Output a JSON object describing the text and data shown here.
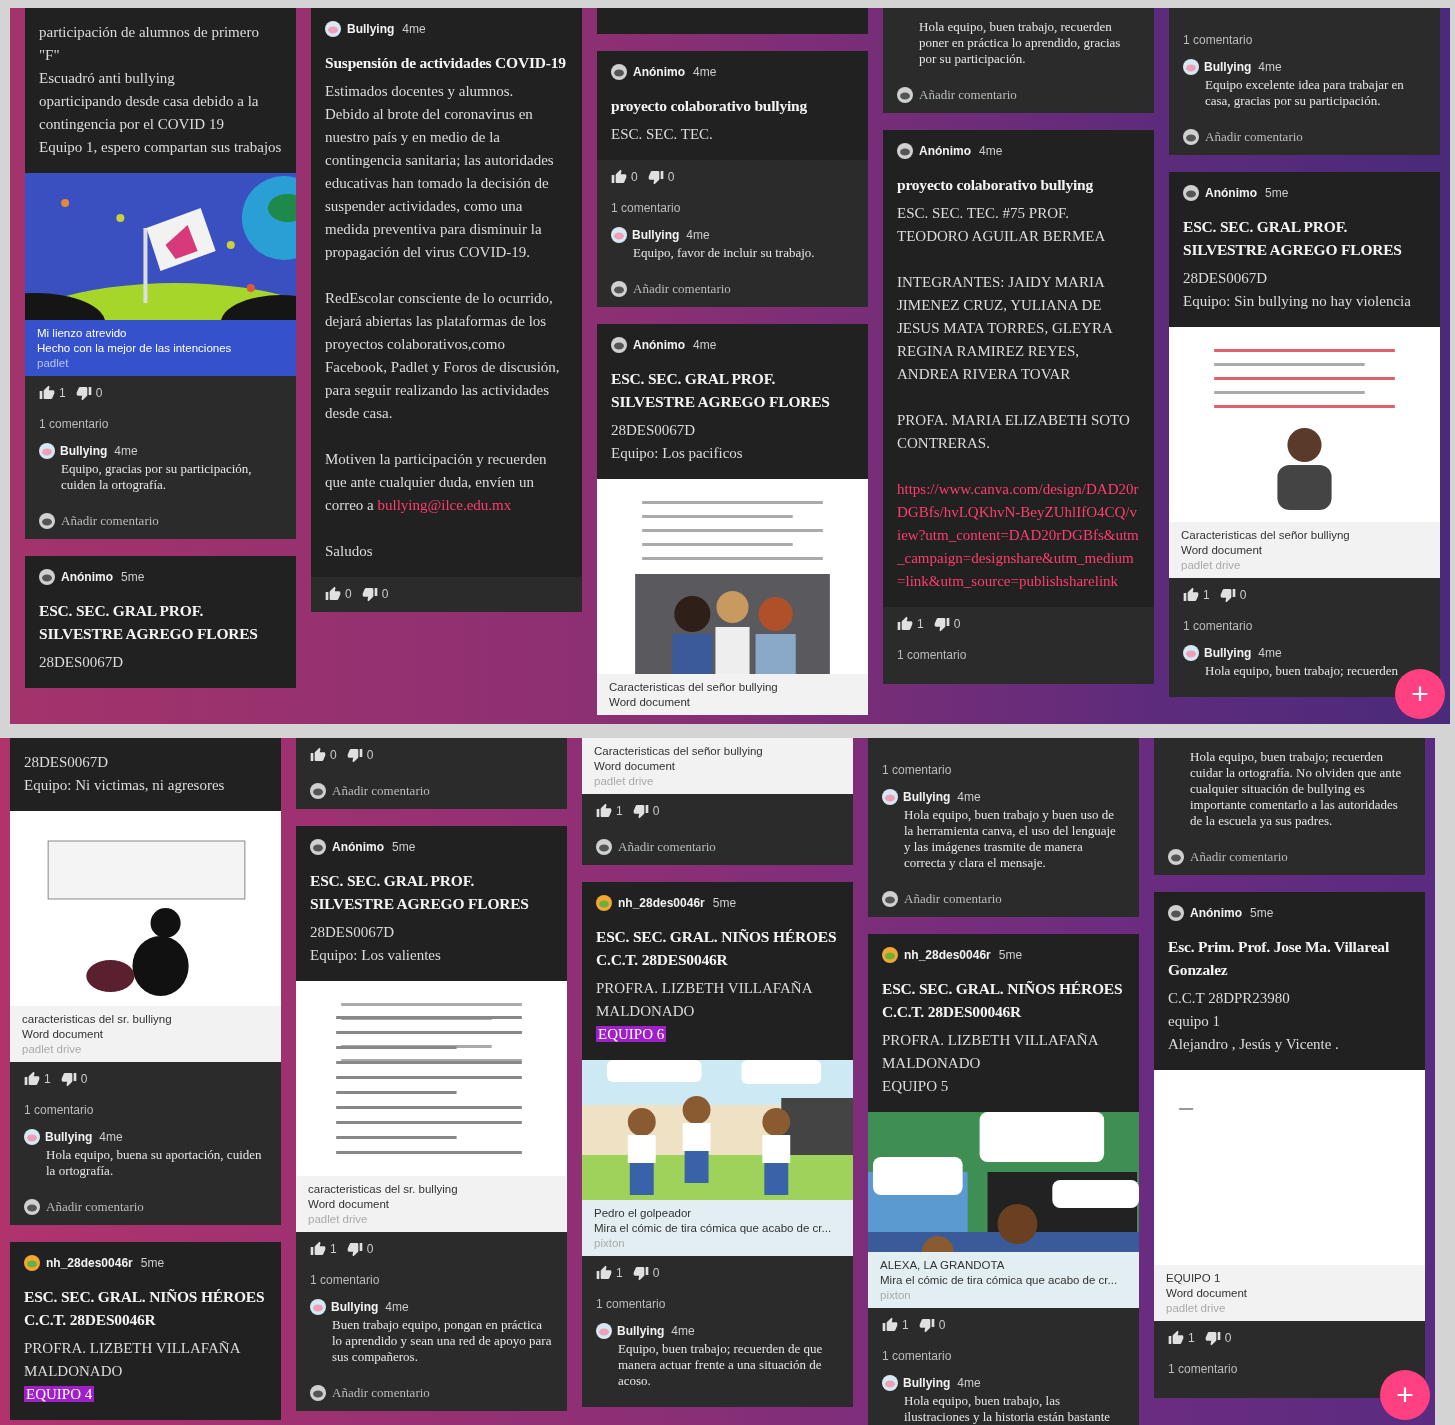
{
  "panels": [
    {
      "fab": "+",
      "columns": [
        [
          {
            "kind": "post",
            "body": [
              {
                "kind": "text",
                "text": "participación de alumnos de primero"
              },
              {
                "kind": "text",
                "text": "\"F\""
              },
              {
                "kind": "text",
                "text": "Escuadró anti bullying"
              },
              {
                "kind": "text",
                "text": "oparticipando desde casa debido a la contingencia por el COVID 19"
              },
              {
                "kind": "text",
                "text": "Equipo 1, espero compartan sus trabajos"
              }
            ],
            "attachment": {
              "kind": "artwork",
              "title": "Mi lienzo atrevido",
              "subtitle": "Hecho con la mejor de las intenciones",
              "source": "padlet"
            },
            "likes": "1",
            "dislikes": "0",
            "comment_count": "1 comentario",
            "comments": [
              {
                "author": "Bullying",
                "time": "4me",
                "avatar": {
                  "kind": "bullying"
                },
                "text": "Equipo, gracias por su participación, cuiden la ortografía."
              }
            ],
            "add_comment": "Añadir comentario"
          },
          {
            "kind": "post",
            "author": "Anónimo",
            "time": "5me",
            "avatar": {
              "kind": "anonymous"
            },
            "title": "ESC. SEC. GRAL PROF. SILVESTRE AGREGO FLORES",
            "body": [
              {
                "kind": "text",
                "text": "28DES0067D"
              }
            ]
          }
        ],
        [
          {
            "kind": "post",
            "author": "Bullying",
            "time": "4me",
            "avatar": {
              "kind": "bullying"
            },
            "title": "Suspensión de actividades COVID-19",
            "body": [
              {
                "kind": "text",
                "text": "Estimados docentes y alumnos."
              },
              {
                "kind": "text",
                "text": "Debido al brote del coronavirus en nuestro país y en medio de la contingencia sanitaria; las autoridades educativas han tomado la decisión de suspender actividades, como una medida preventiva para disminuir la propagación del virus COVID-19."
              },
              {
                "kind": "text",
                "gap_before": true,
                "text": "RedEscolar consciente de lo ocurrido, dejará abiertas las plataformas de los proyectos colaborativos,como Facebook, Padlet y Foros de discusión, para seguir realizando las actividades desde casa."
              },
              {
                "kind": "text",
                "gap_before": true,
                "text": "Motiven la participación y recuerden que ante cualquier duda, envíen un correo a ",
                "link": "bullying@ilce.edu.mx"
              },
              {
                "kind": "text",
                "gap_before": true,
                "text": "Saludos"
              }
            ],
            "likes": "0",
            "dislikes": "0"
          }
        ],
        [
          {
            "kind": "edge"
          },
          {
            "kind": "post",
            "author": "Anónimo",
            "time": "4me",
            "avatar": {
              "kind": "anonymous"
            },
            "title": "proyecto colaborativo bullying",
            "body": [
              {
                "kind": "text",
                "text": "ESC. SEC. TEC."
              }
            ],
            "likes": "0",
            "dislikes": "0",
            "comment_count": "1 comentario",
            "comments": [
              {
                "author": "Bullying",
                "time": "4me",
                "avatar": {
                  "kind": "bullying"
                },
                "text": "Equipo, favor de incluir su trabajo."
              }
            ],
            "add_comment": "Añadir comentario"
          },
          {
            "kind": "post",
            "author": "Anónimo",
            "time": "4me",
            "avatar": {
              "kind": "anonymous"
            },
            "title": "ESC. SEC. GRAL PROF. SILVESTRE AGREGO FLORES",
            "body": [
              {
                "kind": "text",
                "text": "28DES0067D"
              },
              {
                "kind": "text",
                "text": "Equipo: Los pacificos"
              }
            ],
            "attachment": {
              "kind": "document",
              "title": "Caracteristicas del señor bullying",
              "subtitle": "Word document"
            }
          }
        ],
        [
          {
            "kind": "post",
            "comments": [
              {
                "text": "Hola equipo, buen trabajo, recuerden poner en práctica lo aprendido, gracias por su participación."
              }
            ],
            "add_comment": "Añadir comentario"
          },
          {
            "kind": "post",
            "author": "Anónimo",
            "time": "4me",
            "avatar": {
              "kind": "anonymous"
            },
            "title": "proyecto colaborativo  bullying",
            "body": [
              {
                "kind": "text",
                "text": "ESC. SEC. TEC. #75  PROF. TEODORO AGUILAR BERMEA"
              },
              {
                "kind": "text",
                "gap_before": true,
                "text": "INTEGRANTES: JAIDY MARIA JIMENEZ CRUZ, YULIANA DE JESUS MATA TORRES, GLEYRA REGINA RAMIREZ REYES, ANDREA RIVERA TOVAR"
              },
              {
                "kind": "text",
                "gap_before": true,
                "text": "PROFA. MARIA ELIZABETH SOTO CONTRERAS."
              },
              {
                "kind": "link",
                "gap_before": true,
                "text": "https://www.canva.com/design/DAD20rDGBfs/hvLQKhvN-BeyZUhlIfO4CQ/view?utm_content=DAD20rDGBfs&utm_campaign=designshare&utm_medium=link&utm_source=publishsharelink"
              }
            ],
            "likes": "1",
            "dislikes": "0",
            "comment_count": "1 comentario"
          }
        ],
        [
          {
            "kind": "post",
            "comment_count": "1 comentario",
            "comments": [
              {
                "author": "Bullying",
                "time": "4me",
                "avatar": {
                  "kind": "bullying"
                },
                "text": "Equipo excelente idea para trabajar en casa, gracias por su participación."
              }
            ],
            "add_comment": "Añadir comentario"
          },
          {
            "kind": "post",
            "author": "Anónimo",
            "time": "5me",
            "avatar": {
              "kind": "anonymous"
            },
            "title": "ESC. SEC. GRAL PROF. SILVESTRE AGREGO FLORES",
            "body": [
              {
                "kind": "text",
                "text": "28DES0067D"
              },
              {
                "kind": "text",
                "text": "Equipo: Sin bullying no hay violencia"
              }
            ],
            "attachment": {
              "kind": "document",
              "title": "Caracteristicas del señor bulliyng",
              "subtitle": "Word document",
              "source": "padlet drive"
            },
            "likes": "1",
            "dislikes": "0",
            "comment_count": "1 comentario",
            "comments": [
              {
                "author": "Bullying",
                "time": "4me",
                "avatar": {
                  "kind": "bullying"
                },
                "text": "Hola equipo, buen trabajo; recuerden"
              }
            ]
          }
        ]
      ]
    },
    {
      "fab": "+",
      "columns": [
        [
          {
            "kind": "post",
            "body": [
              {
                "kind": "text",
                "text": "28DES0067D"
              },
              {
                "kind": "text",
                "text": "Equipo: Ni victimas, ni agresores"
              }
            ],
            "attachment": {
              "kind": "document",
              "title": "caracteristicas del sr. bulliyng",
              "subtitle": "Word document",
              "source": "padlet drive"
            },
            "likes": "1",
            "dislikes": "0",
            "comment_count": "1 comentario",
            "comments": [
              {
                "author": "Bullying",
                "time": "4me",
                "avatar": {
                  "kind": "bullying"
                },
                "text": "Hola equipo, buena su aportación, cuiden la ortografía."
              }
            ],
            "add_comment": "Añadir comentario"
          },
          {
            "kind": "post",
            "author": "nh_28des0046r",
            "time": "5me",
            "avatar": {
              "kind": "team"
            },
            "title": "ESC. SEC. GRAL. NIÑOS HÉROES C.C.T. 28DES0046R",
            "body": [
              {
                "kind": "text",
                "text": "PROFRA. LIZBETH VILLAFAÑA MALDONADO"
              },
              {
                "kind": "highlight",
                "text": "EQUIPO 4"
              }
            ]
          }
        ],
        [
          {
            "kind": "post",
            "likes": "0",
            "dislikes": "0",
            "add_comment": "Añadir comentario"
          },
          {
            "kind": "post",
            "author": "Anónimo",
            "time": "5me",
            "avatar": {
              "kind": "anonymous"
            },
            "title": "ESC. SEC. GRAL PROF. SILVESTRE AGREGO FLORES",
            "body": [
              {
                "kind": "text",
                "text": "28DES0067D"
              },
              {
                "kind": "text",
                "text": "Equipo: Los valientes"
              }
            ],
            "attachment": {
              "kind": "document",
              "title": "caracteristicas del sr. bullying",
              "subtitle": "Word document",
              "source": "padlet drive"
            },
            "likes": "1",
            "dislikes": "0",
            "comment_count": "1 comentario",
            "comments": [
              {
                "author": "Bullying",
                "time": "4me",
                "avatar": {
                  "kind": "bullying"
                },
                "text": "Buen trabajo equipo, pongan en práctica lo aprendido y sean una red de apoyo para sus compañeros."
              }
            ],
            "add_comment": "Añadir comentario"
          }
        ],
        [
          {
            "kind": "post",
            "attachment": {
              "kind": "caption",
              "title": "Caracteristicas del señor bullying",
              "subtitle": "Word document",
              "source": "padlet drive"
            },
            "likes": "1",
            "dislikes": "0",
            "add_comment": "Añadir comentario"
          },
          {
            "kind": "post",
            "author": "nh_28des0046r",
            "time": "5me",
            "avatar": {
              "kind": "team"
            },
            "title": "ESC. SEC. GRAL. NIÑOS HÉROES C.C.T. 28DES0046R",
            "body": [
              {
                "kind": "text",
                "text": "PROFRA. LIZBETH VILLAFAÑA MALDONADO"
              },
              {
                "kind": "highlight",
                "text": "EQUIPO 6"
              }
            ],
            "attachment": {
              "kind": "comic",
              "title": "Pedro el golpeador",
              "subtitle": "Mira el cómic de tira cómica que acabo de cr...",
              "source": "pixton"
            },
            "likes": "1",
            "dislikes": "0",
            "comment_count": "1 comentario",
            "comments": [
              {
                "author": "Bullying",
                "time": "4me",
                "avatar": {
                  "kind": "bullying"
                },
                "text": "Equipo, buen trabajo; recuerden de que manera actuar frente a una situación de acoso."
              }
            ]
          }
        ],
        [
          {
            "kind": "post",
            "comment_count": "1 comentario",
            "comments": [
              {
                "author": "Bullying",
                "time": "4me",
                "avatar": {
                  "kind": "bullying"
                },
                "text": "Hola equipo, buen trabajo y buen uso de la herramienta canva, el uso del lenguaje y las imágenes trasmite de manera correcta y clara el mensaje."
              }
            ],
            "add_comment": "Añadir comentario"
          },
          {
            "kind": "post",
            "author": "nh_28des0046r",
            "time": "5me",
            "avatar": {
              "kind": "team"
            },
            "title": "ESC. SEC. GRAL. NIÑOS HÉROES C.C.T. 28DES00046R",
            "body": [
              {
                "kind": "text",
                "text": "PROFRA. LIZBETH VILLAFAÑA MALDONADO"
              },
              {
                "kind": "text",
                "text": "EQUIPO 5"
              }
            ],
            "attachment": {
              "kind": "comic",
              "title": "ALEXA, LA GRANDOTA",
              "subtitle": "Mira el cómic de tira cómica que acabo de cr...",
              "source": "pixton"
            },
            "likes": "1",
            "dislikes": "0",
            "comment_count": "1 comentario",
            "comments": [
              {
                "author": "Bullying",
                "time": "4me",
                "avatar": {
                  "kind": "bullying"
                },
                "text": "Hola equipo, buen trabajo, las ilustraciones y la historia están bastante"
              }
            ]
          }
        ],
        [
          {
            "kind": "post",
            "comments": [
              {
                "text": "Hola equipo, buen trabajo; recuerden cuidar la ortografía. No olviden que ante cualquier situación de bullying es importante comentarlo a las autoridades de la escuela ya sus padres."
              }
            ],
            "add_comment": "Añadir comentario"
          },
          {
            "kind": "post",
            "author": "Anónimo",
            "time": "5me",
            "avatar": {
              "kind": "anonymous"
            },
            "title": "Esc. Prim. Prof. Jose Ma. Villareal Gonzalez",
            "body": [
              {
                "kind": "text",
                "text": "C.C.T 28DPR23980"
              },
              {
                "kind": "text",
                "text": "equipo 1"
              },
              {
                "kind": "text",
                "text": " Alejandro , Jesús y Vicente ."
              }
            ],
            "attachment": {
              "kind": "document",
              "title": "EQUIPO 1",
              "subtitle": "Word document",
              "source": "padlet drive"
            },
            "likes": "1",
            "dislikes": "0",
            "comment_count": "1 comentario"
          }
        ]
      ]
    }
  ]
}
